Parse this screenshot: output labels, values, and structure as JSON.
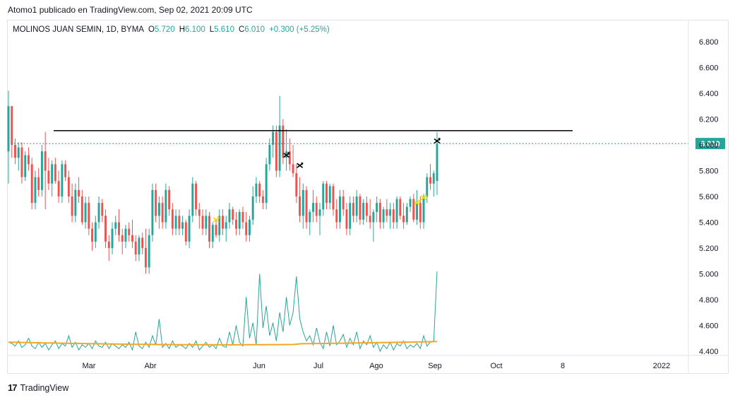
{
  "attribution": "Atomo1 publicado en TradingView.com, Sep 02, 2021 20:09 UTC",
  "footer": {
    "brand": "TradingView",
    "logo_text": "17"
  },
  "legend": {
    "symbol": "MOLINOS JUAN SEMIN, 1D, BYMA",
    "open_label": "O",
    "open": "5.720",
    "high_label": "H",
    "high": "6.100",
    "low_label": "L",
    "low": "5.610",
    "close_label": "C",
    "close": "6.010",
    "change": "+0.300 (+5.25%)"
  },
  "colors": {
    "up": "#26a69a",
    "down": "#ef5350",
    "volume_line": "#26a69a",
    "volume_ma": "#f5a623",
    "resistance": "#000000",
    "last_price": "#26a69a"
  },
  "chart_data": {
    "type": "candlestick",
    "price_axis": {
      "ticks": [
        "6.800",
        "6.600",
        "6.400",
        "6.200",
        "6.000",
        "5.800",
        "5.600",
        "5.400",
        "5.200",
        "5.000",
        "4.800",
        "4.600",
        "4.400"
      ],
      "range": [
        4.35,
        6.95
      ]
    },
    "time_axis": {
      "labels": [
        "Mar",
        "Abr",
        "Jun",
        "Jul",
        "Ago",
        "Sep",
        "Oct",
        "8",
        "2022"
      ]
    },
    "last_price": "6.010",
    "resistance_level": 6.11,
    "ohlc": [
      [
        5.95,
        6.42,
        5.7,
        6.3
      ],
      [
        6.3,
        6.3,
        5.9,
        6.0
      ],
      [
        6.0,
        6.05,
        5.85,
        5.9
      ],
      [
        5.9,
        6.02,
        5.8,
        5.98
      ],
      [
        5.98,
        6.02,
        5.7,
        5.75
      ],
      [
        5.75,
        5.95,
        5.72,
        5.92
      ],
      [
        5.92,
        5.98,
        5.8,
        5.85
      ],
      [
        5.85,
        5.9,
        5.5,
        5.55
      ],
      [
        5.55,
        5.8,
        5.5,
        5.75
      ],
      [
        5.75,
        5.82,
        5.6,
        5.65
      ],
      [
        5.65,
        6.0,
        5.6,
        5.95
      ],
      [
        5.95,
        6.1,
        5.5,
        5.8
      ],
      [
        5.8,
        5.9,
        5.65,
        5.7
      ],
      [
        5.7,
        5.88,
        5.6,
        5.85
      ],
      [
        5.85,
        5.9,
        5.7,
        5.72
      ],
      [
        5.72,
        5.8,
        5.55,
        5.6
      ],
      [
        5.6,
        5.88,
        5.55,
        5.85
      ],
      [
        5.85,
        5.88,
        5.72,
        5.75
      ],
      [
        5.75,
        5.8,
        5.55,
        5.6
      ],
      [
        5.6,
        5.7,
        5.4,
        5.45
      ],
      [
        5.45,
        5.7,
        5.4,
        5.65
      ],
      [
        5.65,
        5.75,
        5.55,
        5.6
      ],
      [
        5.6,
        5.65,
        5.38,
        5.4
      ],
      [
        5.4,
        5.6,
        5.35,
        5.55
      ],
      [
        5.55,
        5.6,
        5.3,
        5.35
      ],
      [
        5.35,
        5.4,
        5.18,
        5.25
      ],
      [
        5.25,
        5.45,
        5.2,
        5.4
      ],
      [
        5.4,
        5.6,
        5.35,
        5.55
      ],
      [
        5.55,
        5.58,
        5.4,
        5.45
      ],
      [
        5.45,
        5.5,
        5.2,
        5.25
      ],
      [
        5.25,
        5.3,
        5.1,
        5.2
      ],
      [
        5.2,
        5.4,
        5.15,
        5.35
      ],
      [
        5.35,
        5.45,
        5.3,
        5.4
      ],
      [
        5.4,
        5.5,
        5.25,
        5.3
      ],
      [
        5.3,
        5.35,
        5.15,
        5.25
      ],
      [
        5.25,
        5.38,
        5.2,
        5.35
      ],
      [
        5.35,
        5.4,
        5.25,
        5.3
      ],
      [
        5.3,
        5.42,
        5.2,
        5.25
      ],
      [
        5.25,
        5.3,
        5.1,
        5.15
      ],
      [
        5.15,
        5.3,
        5.1,
        5.28
      ],
      [
        5.28,
        5.32,
        5.15,
        5.2
      ],
      [
        5.2,
        5.35,
        5.0,
        5.05
      ],
      [
        5.05,
        5.35,
        5.0,
        5.3
      ],
      [
        5.3,
        5.7,
        5.25,
        5.65
      ],
      [
        5.65,
        5.7,
        5.4,
        5.45
      ],
      [
        5.45,
        5.6,
        5.35,
        5.55
      ],
      [
        5.55,
        5.6,
        5.35,
        5.4
      ],
      [
        5.4,
        5.7,
        5.35,
        5.65
      ],
      [
        5.65,
        5.68,
        5.45,
        5.5
      ],
      [
        5.5,
        5.55,
        5.3,
        5.35
      ],
      [
        5.35,
        5.5,
        5.3,
        5.45
      ],
      [
        5.45,
        5.5,
        5.3,
        5.35
      ],
      [
        5.35,
        5.45,
        5.3,
        5.4
      ],
      [
        5.4,
        5.42,
        5.22,
        5.25
      ],
      [
        5.25,
        5.5,
        5.2,
        5.45
      ],
      [
        5.45,
        5.75,
        5.4,
        5.7
      ],
      [
        5.7,
        5.72,
        5.45,
        5.5
      ],
      [
        5.5,
        5.55,
        5.35,
        5.45
      ],
      [
        5.45,
        5.5,
        5.3,
        5.35
      ],
      [
        5.35,
        5.5,
        5.3,
        5.45
      ],
      [
        5.45,
        5.48,
        5.2,
        5.25
      ],
      [
        5.25,
        5.4,
        5.2,
        5.38
      ],
      [
        5.38,
        5.42,
        5.28,
        5.3
      ],
      [
        5.3,
        5.5,
        5.25,
        5.45
      ],
      [
        5.45,
        5.5,
        5.3,
        5.35
      ],
      [
        5.35,
        5.45,
        5.25,
        5.4
      ],
      [
        5.4,
        5.55,
        5.35,
        5.5
      ],
      [
        5.5,
        5.52,
        5.38,
        5.42
      ],
      [
        5.42,
        5.48,
        5.3,
        5.35
      ],
      [
        5.35,
        5.5,
        5.3,
        5.48
      ],
      [
        5.48,
        5.52,
        5.35,
        5.4
      ],
      [
        5.4,
        5.48,
        5.25,
        5.3
      ],
      [
        5.3,
        5.45,
        5.25,
        5.42
      ],
      [
        5.42,
        5.68,
        5.38,
        5.6
      ],
      [
        5.6,
        5.75,
        5.55,
        5.7
      ],
      [
        5.7,
        5.72,
        5.55,
        5.6
      ],
      [
        5.6,
        5.65,
        5.5,
        5.55
      ],
      [
        5.55,
        5.9,
        5.5,
        5.85
      ],
      [
        5.85,
        6.05,
        5.8,
        6.0
      ],
      [
        6.0,
        6.15,
        5.9,
        6.1
      ],
      [
        6.1,
        6.15,
        5.75,
        5.8
      ],
      [
        5.8,
        6.38,
        5.75,
        6.15
      ],
      [
        6.15,
        6.2,
        5.85,
        5.9
      ],
      [
        5.9,
        6.12,
        5.8,
        5.95
      ],
      [
        5.95,
        6.05,
        5.8,
        5.85
      ],
      [
        5.85,
        6.0,
        5.75,
        5.78
      ],
      [
        5.78,
        5.85,
        5.55,
        5.6
      ],
      [
        5.6,
        5.75,
        5.4,
        5.45
      ],
      [
        5.45,
        5.7,
        5.35,
        5.65
      ],
      [
        5.65,
        5.68,
        5.35,
        5.4
      ],
      [
        5.4,
        5.5,
        5.3,
        5.48
      ],
      [
        5.48,
        5.65,
        5.4,
        5.55
      ],
      [
        5.55,
        5.6,
        5.4,
        5.45
      ],
      [
        5.45,
        5.55,
        5.3,
        5.5
      ],
      [
        5.5,
        5.72,
        5.45,
        5.7
      ],
      [
        5.7,
        5.72,
        5.5,
        5.55
      ],
      [
        5.55,
        5.7,
        5.5,
        5.68
      ],
      [
        5.68,
        5.7,
        5.45,
        5.5
      ],
      [
        5.5,
        5.58,
        5.35,
        5.4
      ],
      [
        5.4,
        5.65,
        5.35,
        5.6
      ],
      [
        5.6,
        5.65,
        5.45,
        5.5
      ],
      [
        5.5,
        5.55,
        5.3,
        5.35
      ],
      [
        5.35,
        5.6,
        5.3,
        5.55
      ],
      [
        5.55,
        5.6,
        5.4,
        5.45
      ],
      [
        5.45,
        5.65,
        5.4,
        5.6
      ],
      [
        5.6,
        5.62,
        5.38,
        5.42
      ],
      [
        5.42,
        5.58,
        5.38,
        5.55
      ],
      [
        5.55,
        5.6,
        5.4,
        5.45
      ],
      [
        5.45,
        5.58,
        5.35,
        5.4
      ],
      [
        5.4,
        5.5,
        5.25,
        5.48
      ],
      [
        5.48,
        5.6,
        5.4,
        5.55
      ],
      [
        5.55,
        5.58,
        5.35,
        5.4
      ],
      [
        5.4,
        5.52,
        5.35,
        5.5
      ],
      [
        5.5,
        5.58,
        5.4,
        5.45
      ],
      [
        5.45,
        5.55,
        5.35,
        5.5
      ],
      [
        5.5,
        5.55,
        5.35,
        5.4
      ],
      [
        5.4,
        5.6,
        5.35,
        5.58
      ],
      [
        5.58,
        5.6,
        5.42,
        5.45
      ],
      [
        5.45,
        5.55,
        5.35,
        5.4
      ],
      [
        5.4,
        5.55,
        5.38,
        5.52
      ],
      [
        5.52,
        5.6,
        5.48,
        5.58
      ],
      [
        5.58,
        5.62,
        5.4,
        5.42
      ],
      [
        5.42,
        5.65,
        5.38,
        5.55
      ],
      [
        5.55,
        5.6,
        5.35,
        5.4
      ],
      [
        5.4,
        5.62,
        5.35,
        5.6
      ],
      [
        5.6,
        5.78,
        5.55,
        5.75
      ],
      [
        5.75,
        5.85,
        5.65,
        5.7
      ],
      [
        5.7,
        5.8,
        5.6,
        5.78
      ],
      [
        5.72,
        6.1,
        5.61,
        6.01
      ]
    ],
    "volume": [
      4.47,
      4.46,
      4.44,
      4.48,
      4.43,
      4.45,
      4.5,
      4.44,
      4.42,
      4.47,
      4.43,
      4.46,
      4.41,
      4.45,
      4.48,
      4.42,
      4.46,
      4.44,
      4.52,
      4.43,
      4.47,
      4.41,
      4.45,
      4.43,
      4.46,
      4.42,
      4.48,
      4.44,
      4.43,
      4.47,
      4.42,
      4.46,
      4.44,
      4.42,
      4.45,
      4.43,
      4.47,
      4.41,
      4.55,
      4.44,
      4.42,
      4.47,
      4.43,
      4.52,
      4.45,
      4.65,
      4.43,
      4.46,
      4.42,
      4.48,
      4.43,
      4.45,
      4.44,
      4.42,
      4.46,
      4.43,
      4.48,
      4.41,
      4.44,
      4.47,
      4.43,
      4.45,
      4.42,
      4.5,
      4.44,
      4.43,
      4.55,
      4.45,
      4.6,
      4.47,
      4.44,
      4.82,
      4.5,
      4.62,
      4.45,
      5.0,
      4.58,
      4.75,
      4.52,
      4.62,
      4.48,
      4.7,
      4.55,
      4.82,
      4.6,
      4.7,
      4.98,
      4.65,
      4.55,
      4.48,
      4.52,
      4.45,
      4.58,
      4.47,
      4.42,
      4.55,
      4.44,
      4.6,
      4.45,
      4.48,
      4.53,
      4.43,
      4.5,
      4.45,
      4.55,
      4.42,
      4.48,
      4.45,
      4.52,
      4.43,
      4.47,
      4.4,
      4.45,
      4.42,
      4.47,
      4.41,
      4.46,
      4.44,
      4.48,
      4.42,
      4.45,
      4.43,
      4.46,
      4.42,
      4.52,
      4.44,
      4.47,
      4.48,
      5.02
    ],
    "volume_ma_level": 4.47,
    "markers": [
      {
        "type": "sell",
        "index": 83,
        "price": 5.92
      },
      {
        "type": "sell",
        "index": 87,
        "price": 5.84
      },
      {
        "type": "buy",
        "index": 62,
        "price": 5.42
      },
      {
        "type": "buy",
        "index": 122,
        "price": 5.55
      },
      {
        "type": "buy",
        "index": 124,
        "price": 5.59
      },
      {
        "type": "sell",
        "index": 128,
        "price": 6.03
      }
    ]
  }
}
